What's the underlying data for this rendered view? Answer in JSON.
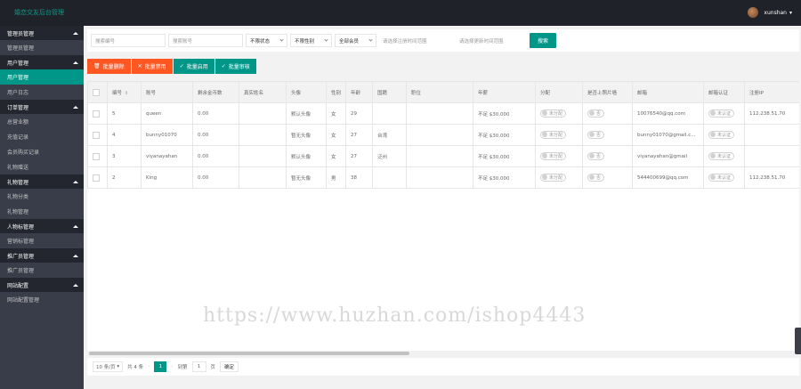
{
  "app": {
    "title": "婚恋交友后台管理"
  },
  "header": {
    "username": "xunshan"
  },
  "sidebar": {
    "groups": [
      {
        "title": "管理员管理",
        "items": [
          "管理员管理"
        ]
      },
      {
        "title": "用户管理",
        "items": [
          "用户管理",
          "用户日志"
        ]
      },
      {
        "title": "订单管理",
        "items": [
          "总营业额",
          "充值记录",
          "会员购买记录",
          "礼物赠送"
        ]
      },
      {
        "title": "礼物管理",
        "items": [
          "礼物分类",
          "礼物管理"
        ]
      },
      {
        "title": "人物标管理",
        "items": [
          "营销标管理"
        ]
      },
      {
        "title": "推广员管理",
        "items": [
          "推广员管理"
        ]
      },
      {
        "title": "网站配置",
        "items": [
          "网站配置管理"
        ]
      }
    ]
  },
  "filters": {
    "id_placeholder": "搜索编号",
    "account_placeholder": "搜索账号",
    "status_value": "不限状态",
    "gender_value": "不限性别",
    "member_value": "全部会员",
    "reg_time_placeholder": "请选择注册时间范围",
    "update_time_placeholder": "请选择更新时间范围",
    "search_label": "搜索"
  },
  "actions": {
    "batch_delete": "批量删除",
    "batch_disable": "批量禁用",
    "batch_enable": "批量启用",
    "batch_review": "批量审核"
  },
  "table": {
    "columns": [
      "编号",
      "账号",
      "剩余金币数",
      "真实姓名",
      "头像",
      "性别",
      "年龄",
      "国籍",
      "职位",
      "年薪",
      "分配",
      "是否上照片墙",
      "邮箱",
      "邮箱认证",
      "注册IP"
    ],
    "rows": [
      {
        "id": "5",
        "account": "queen",
        "coins": "0.00",
        "real_name": "",
        "avatar": "默认头像",
        "gender": "女",
        "age": "29",
        "country": "",
        "job": "",
        "salary": "不足 $30,000",
        "assign": "未分配",
        "photo_wall": "否",
        "email": "10076540@qq.com",
        "email_verify": "未认证",
        "reg_ip": "112.238.51.70"
      },
      {
        "id": "4",
        "account": "bunny01070",
        "coins": "0.00",
        "real_name": "",
        "avatar": "暂无头像",
        "gender": "女",
        "age": "27",
        "country": "台湾",
        "job": "",
        "salary": "不足 $30,000",
        "assign": "未分配",
        "photo_wall": "否",
        "email": "bunny01070@gmail.c...",
        "email_verify": "未认证",
        "reg_ip": ""
      },
      {
        "id": "3",
        "account": "viyanayahan",
        "coins": "0.00",
        "real_name": "",
        "avatar": "默认头像",
        "gender": "女",
        "age": "27",
        "country": "泛州",
        "job": "",
        "salary": "不足 $30,000",
        "assign": "未分配",
        "photo_wall": "否",
        "email": "viyanayahan@gmail",
        "email_verify": "未认证",
        "reg_ip": ""
      },
      {
        "id": "2",
        "account": "King",
        "coins": "0.00",
        "real_name": "",
        "avatar": "暂无头像",
        "gender": "男",
        "age": "38",
        "country": "",
        "job": "",
        "salary": "不足 $30,000",
        "assign": "未分配",
        "photo_wall": "否",
        "email": "544400699@qq.com",
        "email_verify": "未认证",
        "reg_ip": "112.238.51.70"
      }
    ]
  },
  "pager": {
    "page_size": "10 条/页",
    "total": "共 4 条",
    "current": "1",
    "goto_label": "到第",
    "goto_value": "1",
    "page_unit": "页",
    "confirm": "确定"
  },
  "watermark": "https://www.huzhan.com/ishop4443",
  "colors": {
    "accent": "#009688",
    "danger": "#ff5722",
    "header_bg": "#20222a",
    "sidebar_bg": "#393d49"
  }
}
